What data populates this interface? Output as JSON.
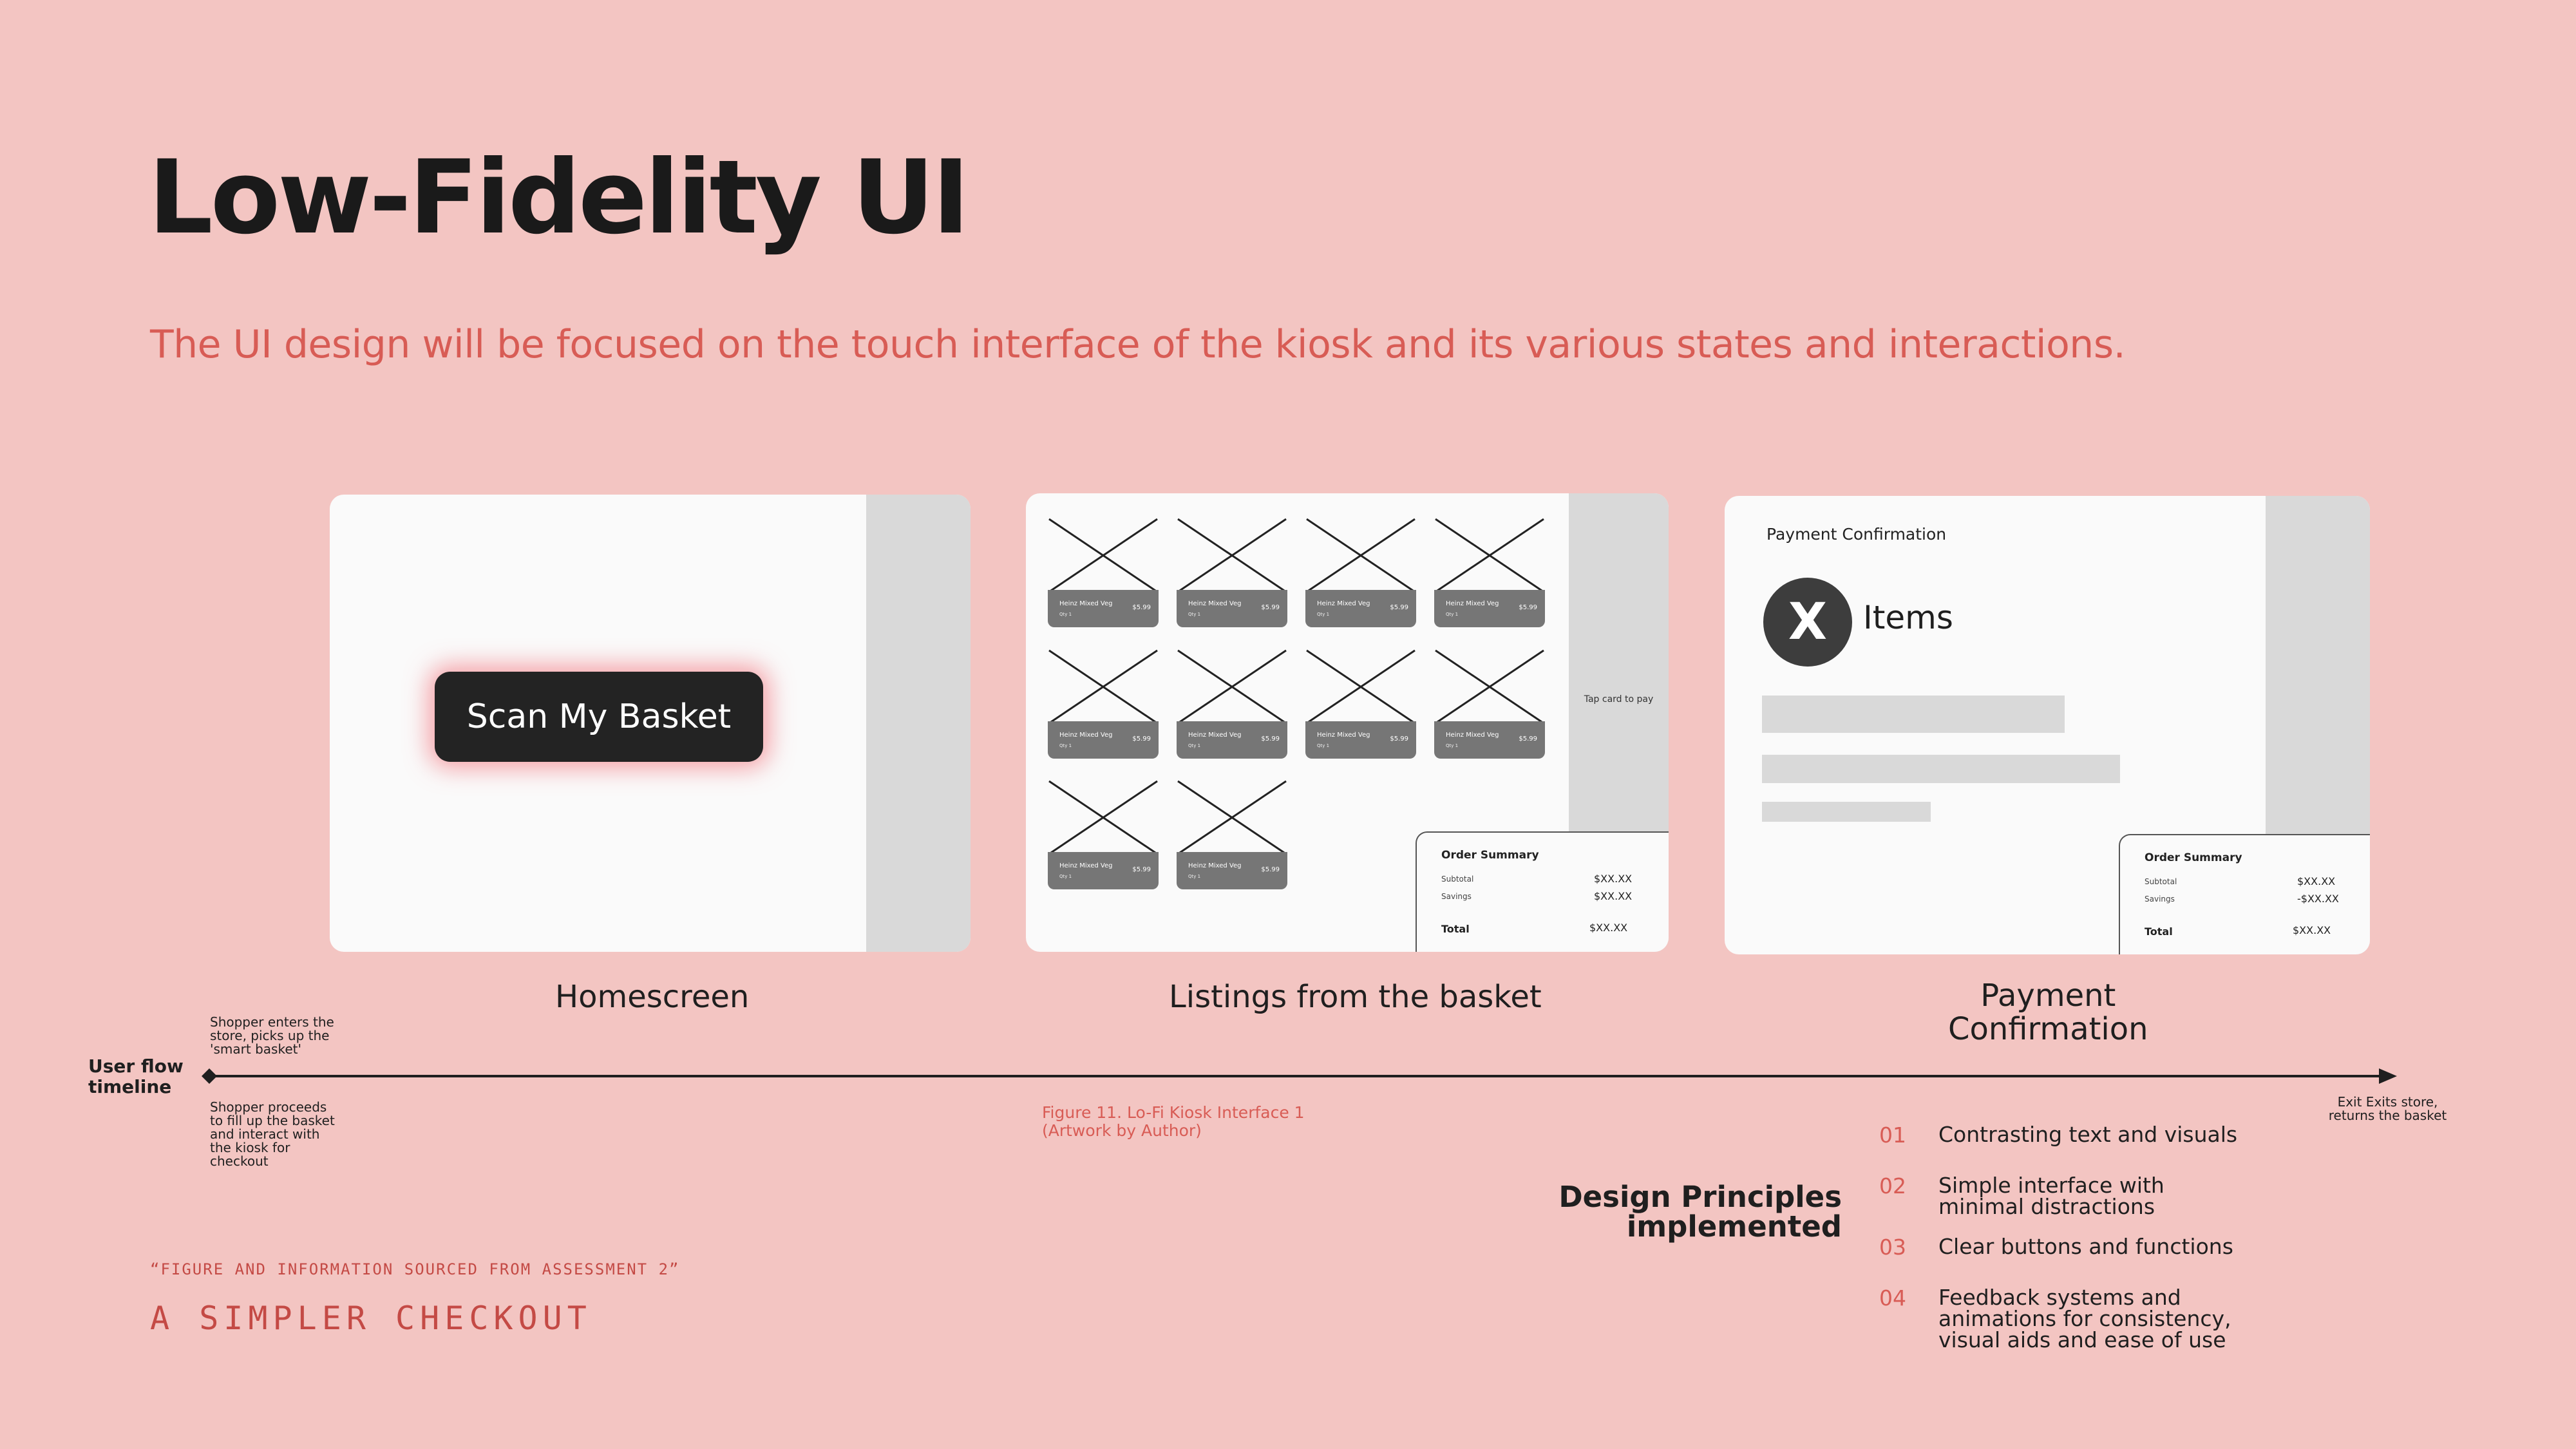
{
  "header": {
    "title": "Low-Fidelity UI",
    "subtitle": "The UI design will be focused on the touch interface of the kiosk and its various states and interactions."
  },
  "homescreen": {
    "button_label": "Scan My Basket",
    "caption": "Homescreen"
  },
  "listings": {
    "caption": "Listings from the basket",
    "product_name": "Heinz Mixed Veg",
    "product_qty": "Qty 1",
    "product_price": "$5.99",
    "tap_text": "Tap card to pay",
    "summary": {
      "title": "Order Summary",
      "subtotal_label": "Subtotal",
      "subtotal_value": "$XX.XX",
      "savings_label": "Savings",
      "savings_value": "$XX.XX",
      "total_label": "Total",
      "total_value": "$XX.XX"
    }
  },
  "payment": {
    "title": "Payment Confirmation",
    "badge": "X",
    "items_label": "Items",
    "caption_line1": "Payment",
    "caption_line2": "Confirmation",
    "summary": {
      "title": "Order Summary",
      "subtotal_label": "Subtotal",
      "subtotal_value": "$XX.XX",
      "savings_label": "Savings",
      "savings_value": "-$XX.XX",
      "total_label": "Total",
      "total_value": "$XX.XX"
    }
  },
  "timeline": {
    "label_line1": "User flow",
    "label_line2": "timeline",
    "start_above": [
      "Shopper enters the",
      "store, picks up the",
      "'smart basket'"
    ],
    "start_below": [
      "Shopper proceeds",
      "to fill up the basket",
      "and interact with",
      "the kiosk for",
      "checkout"
    ],
    "end_text": [
      "Exit Exits store,",
      "returns the basket"
    ]
  },
  "figure_caption": {
    "line1": "Figure 11. Lo-Fi Kiosk Interface 1",
    "line2": "(Artwork by Author)"
  },
  "design_principles": {
    "title_line1": "Design Principles",
    "title_line2": "implemented",
    "items": [
      {
        "num": "01",
        "lines": [
          "Contrasting text and visuals"
        ]
      },
      {
        "num": "02",
        "lines": [
          "Simple interface with",
          "minimal distractions"
        ]
      },
      {
        "num": "03",
        "lines": [
          "Clear buttons and functions"
        ]
      },
      {
        "num": "04",
        "lines": [
          "Feedback systems and",
          "animations for consistency,",
          "visual aids and ease of use"
        ]
      }
    ]
  },
  "footer": {
    "quote": "“FIGURE AND INFORMATION SOURCED FROM ASSESSMENT 2”",
    "tagline": "A SIMPLER CHECKOUT"
  },
  "colors": {
    "background": "#f3c5c2",
    "accent": "#d85c55",
    "dark": "#1f1f1f",
    "screen": "#fafafa",
    "sidebar": "#d9d9d9"
  }
}
